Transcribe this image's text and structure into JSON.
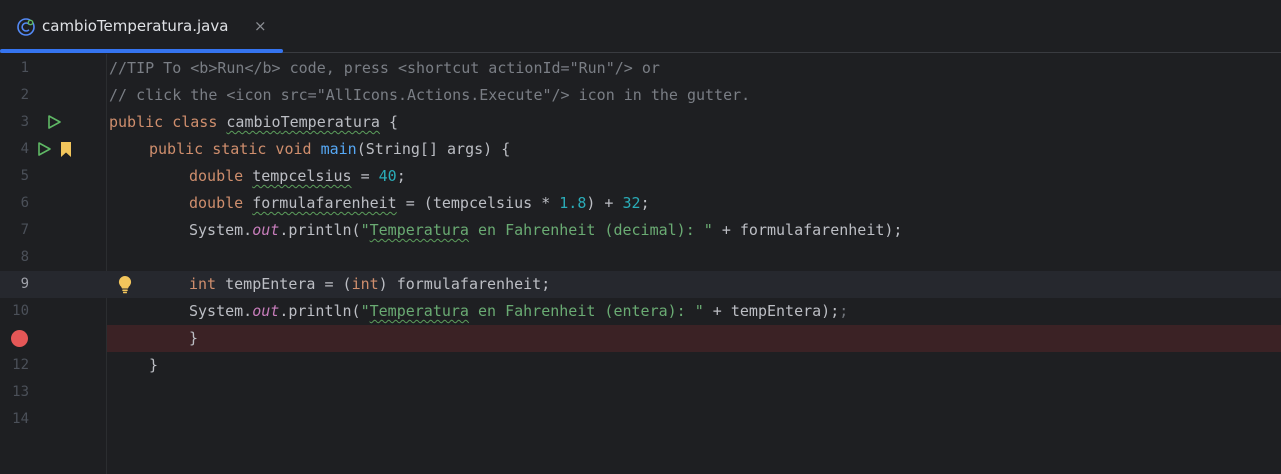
{
  "tab": {
    "filename": "cambioTemperatura.java",
    "close_glyph": "×",
    "icon": "java-class-icon",
    "active_color": "#3574f0"
  },
  "editor": {
    "line_numbers": [
      "1",
      "2",
      "3",
      "4",
      "5",
      "6",
      "7",
      "8",
      "9",
      "10",
      "",
      "12",
      "13",
      "14"
    ],
    "current_line": "9",
    "breakpoint_line": 11,
    "gutter_icons": [
      {
        "line": 3,
        "icon": "run-icon"
      },
      {
        "line": 4,
        "icon": "run-icon"
      },
      {
        "line": 4,
        "icon": "bookmark-icon"
      },
      {
        "line": 9,
        "icon": "lightbulb-icon"
      },
      {
        "line": 11,
        "icon": "breakpoint-icon"
      }
    ],
    "lines": [
      {
        "text": "//TIP To <b>Run</b> code, press <shortcut actionId=\"Run\"/> or"
      },
      {
        "text": "// click the <icon src=\"AllIcons.Actions.Execute\"/> icon in the gutter."
      },
      {
        "text": "public class cambioTemperatura {"
      },
      {
        "text": "    public static void main(String[] args) {"
      },
      {
        "text": "        double tempcelsius = 40;"
      },
      {
        "text": "        double formulafarenheit = (tempcelsius * 1.8) + 32;"
      },
      {
        "text": "        System.out.println(\"Temperatura en Fahrenheit (decimal): \" + formulafarenheit);"
      },
      {
        "text": ""
      },
      {
        "text": "        int tempEntera = (int) formulafarenheit;"
      },
      {
        "text": "        System.out.println(\"Temperatura en Fahrenheit (entera): \" + tempEntera);;"
      },
      {
        "text": "        }"
      },
      {
        "text": "    }"
      },
      {
        "text": ""
      },
      {
        "text": ""
      }
    ],
    "tokens": {
      "l1": "//TIP To <b>Run</b> code, press <shortcut actionId=\"Run\"/> or",
      "l2": "// click the <icon src=\"AllIcons.Actions.Execute\"/> icon in the gutter.",
      "l3_kw": "public class ",
      "l3_name_a": "cambio",
      "l3_name_b": "Temperatura",
      "l3_end": " {",
      "l4_kw": "public static void ",
      "l4_fn": "main",
      "l4_end": "(String[] args) {",
      "l5_kw": "double ",
      "l5_var": "tempcelsius",
      "l5_mid": " = ",
      "l5_num": "40",
      "l5_end": ";",
      "l6_kw": "double ",
      "l6_var": "formulafarenheit",
      "l6_mid": " = (tempcelsius * ",
      "l6_num1": "1.8",
      "l6_mid2": ") + ",
      "l6_num2": "32",
      "l6_end": ";",
      "l7_a": "System.",
      "l7_out": "out",
      "l7_b": ".println(",
      "l7_q": "\"",
      "l7_str_typo": "Temperatura",
      "l7_str_rest": " en Fahrenheit (decimal): \"",
      "l7_end": " + formulafarenheit);",
      "l9_kw": "int",
      "l9_mid": " tempEntera = (",
      "l9_kw2": "int",
      "l9_end": ") formulafarenheit;",
      "l10_a": "System.",
      "l10_out": "out",
      "l10_b": ".println(",
      "l10_q": "\"",
      "l10_str_typo": "Temperatura",
      "l10_str_rest": " en Fahrenheit (entera): \"",
      "l10_end": " + tempEntera);",
      "l10_extra": ";",
      "l11": "}",
      "l12": "}"
    }
  }
}
